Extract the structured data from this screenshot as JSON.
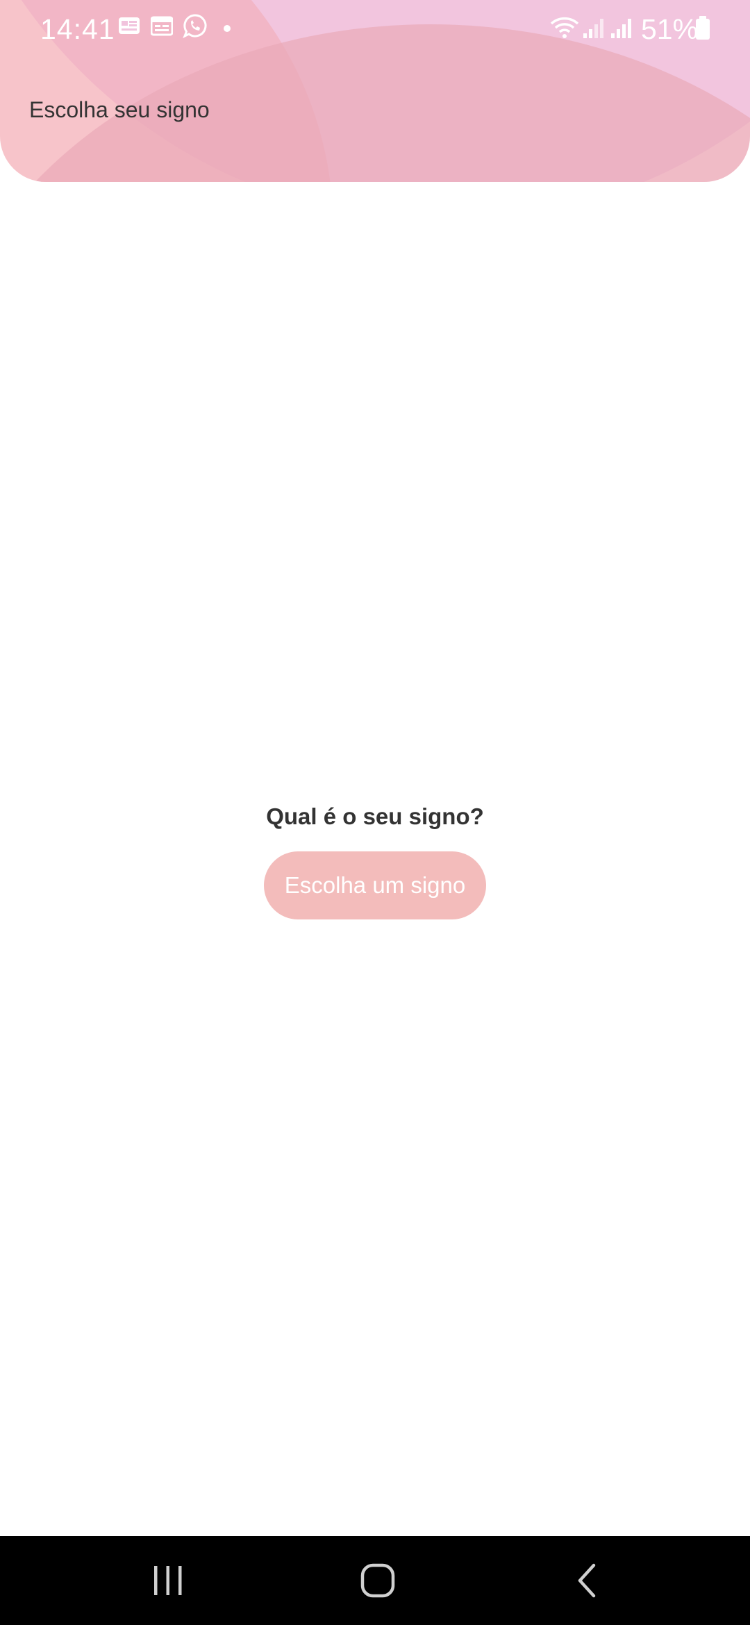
{
  "status_bar": {
    "time": "14:41",
    "battery": "51%",
    "icons": [
      "news-icon",
      "calendar-icon",
      "whatsapp-icon",
      "notification-dot-icon",
      "wifi-icon",
      "signal-icon",
      "signal-icon",
      "battery-icon"
    ]
  },
  "header": {
    "title": "Escolha seu signo"
  },
  "main": {
    "question": "Qual é o seu signo?",
    "button_label": "Escolha um signo"
  },
  "navigation": {
    "buttons": [
      "recent-apps",
      "home",
      "back"
    ]
  },
  "colors": {
    "header_background": "#fde4e6",
    "blob_pink": "#ebadc4",
    "blob_light_pink": "#f1c3dd",
    "blob_rose": "#eab2b8",
    "button_background": "#f3bcbb",
    "text_dark": "#333333"
  }
}
